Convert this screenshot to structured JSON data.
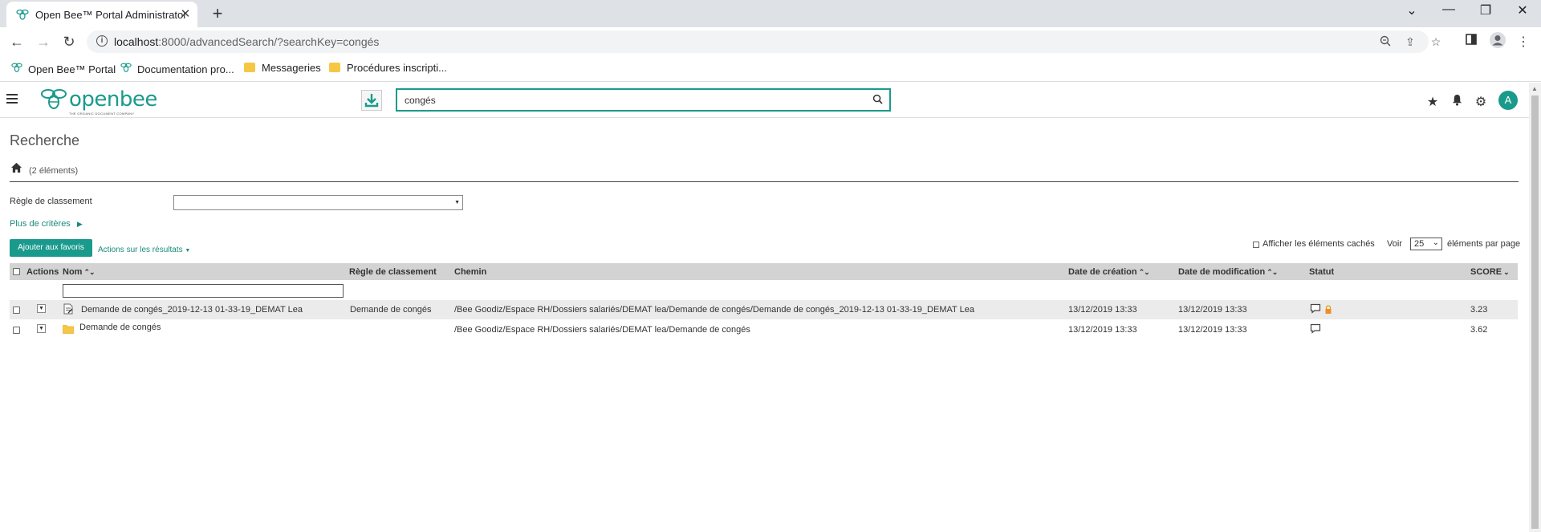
{
  "browser": {
    "tab_title": "Open Bee™ Portal Administrator",
    "new_tab": "+",
    "url_host": "localhost",
    "url_path": ":8000/advancedSearch/?searchKey=congés",
    "bookmarks": [
      {
        "label": "Open Bee™ Portal",
        "icon": "bee-icon"
      },
      {
        "label": "Documentation pro...",
        "icon": "bee-icon"
      },
      {
        "label": "Messageries",
        "icon": "folder-icon"
      },
      {
        "label": "Procédures inscripti...",
        "icon": "folder-icon"
      }
    ]
  },
  "app": {
    "logo_text": "openbee",
    "logo_tagline": "THE ORGANIC DOCUMENT COMPANY",
    "search_value": "congés",
    "avatar_letter": "A",
    "brand_color": "#1a9a8c"
  },
  "page": {
    "title": "Recherche",
    "count": "(2 éléments)",
    "rule_label": "Règle de classement",
    "more_criteria": "Plus de critères",
    "add_favorites": "Ajouter aux favoris",
    "actions_on_results": "Actions sur les résultats",
    "show_hidden": "Afficher les éléments cachés",
    "voir": "Voir",
    "page_size": "25",
    "per_page": "éléments par page"
  },
  "table": {
    "headers": {
      "actions": "Actions",
      "name": "Nom",
      "rule": "Règle de classement",
      "path": "Chemin",
      "created": "Date de création",
      "modified": "Date de modification",
      "status": "Statut",
      "score": "SCORE"
    },
    "rows": [
      {
        "type": "document",
        "name": "Demande de congés_2019-12-13 01-33-19_DEMAT Lea",
        "rule": "Demande de congés",
        "path": "/Bee Goodiz/Espace RH/Dossiers salariés/DEMAT lea/Demande de congés/Demande de congés_2019-12-13 01-33-19_DEMAT Lea",
        "created": "13/12/2019 13:33",
        "modified": "13/12/2019 13:33",
        "score": "3.23"
      },
      {
        "type": "folder",
        "name": "Demande de congés",
        "rule": "",
        "path": "/Bee Goodiz/Espace RH/Dossiers salariés/DEMAT lea/Demande de congés",
        "created": "13/12/2019 13:33",
        "modified": "13/12/2019 13:33",
        "score": "3.62"
      }
    ]
  }
}
